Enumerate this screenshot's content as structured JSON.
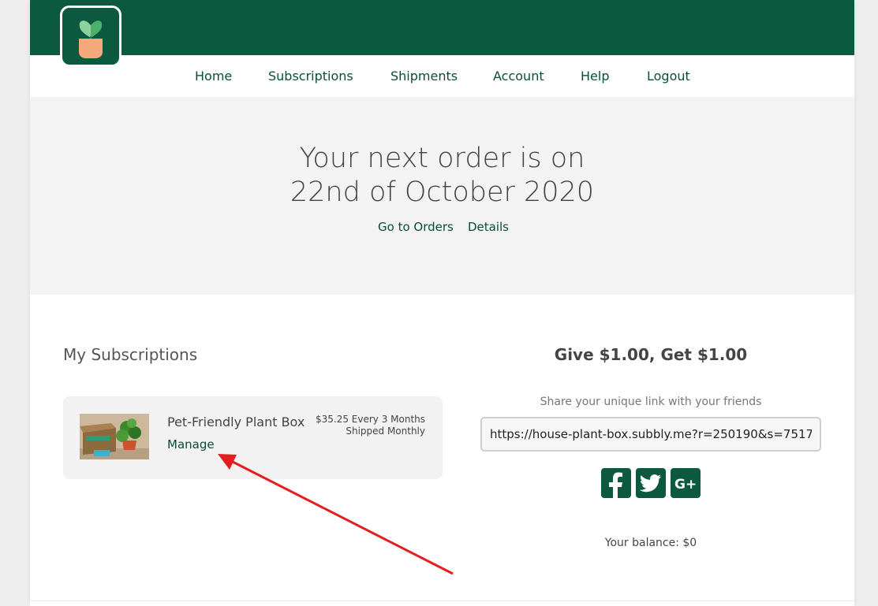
{
  "brand": {
    "logo": "plant-pot-logo"
  },
  "nav": {
    "items": [
      {
        "label": "Home"
      },
      {
        "label": "Subscriptions"
      },
      {
        "label": "Shipments"
      },
      {
        "label": "Account"
      },
      {
        "label": "Help"
      },
      {
        "label": "Logout"
      }
    ]
  },
  "hero": {
    "line1": "Your next order is on",
    "line2": "22nd of October 2020",
    "links": [
      {
        "label": "Go to Orders"
      },
      {
        "label": "Details"
      }
    ]
  },
  "subscriptions": {
    "title": "My Subscriptions",
    "items": [
      {
        "name": "Pet-Friendly Plant Box",
        "manage_label": "Manage",
        "price": "$35.25 Every 3 Months",
        "shipping": "Shipped Monthly",
        "image_icon": "plant-box-image"
      }
    ]
  },
  "referral": {
    "title": "Give $1.00, Get $1.00",
    "subtitle": "Share your unique link with your friends",
    "link_value": "https://house-plant-box.subbly.me?r=250190&s=7517",
    "social": [
      {
        "icon": "facebook-icon"
      },
      {
        "icon": "twitter-icon"
      },
      {
        "icon": "google-plus-icon"
      }
    ],
    "balance": "Your balance: $0"
  },
  "colors": {
    "brand_green": "#0b5a3f",
    "link_green": "#0b4d37",
    "annotation_arrow": "#e31e1e"
  }
}
